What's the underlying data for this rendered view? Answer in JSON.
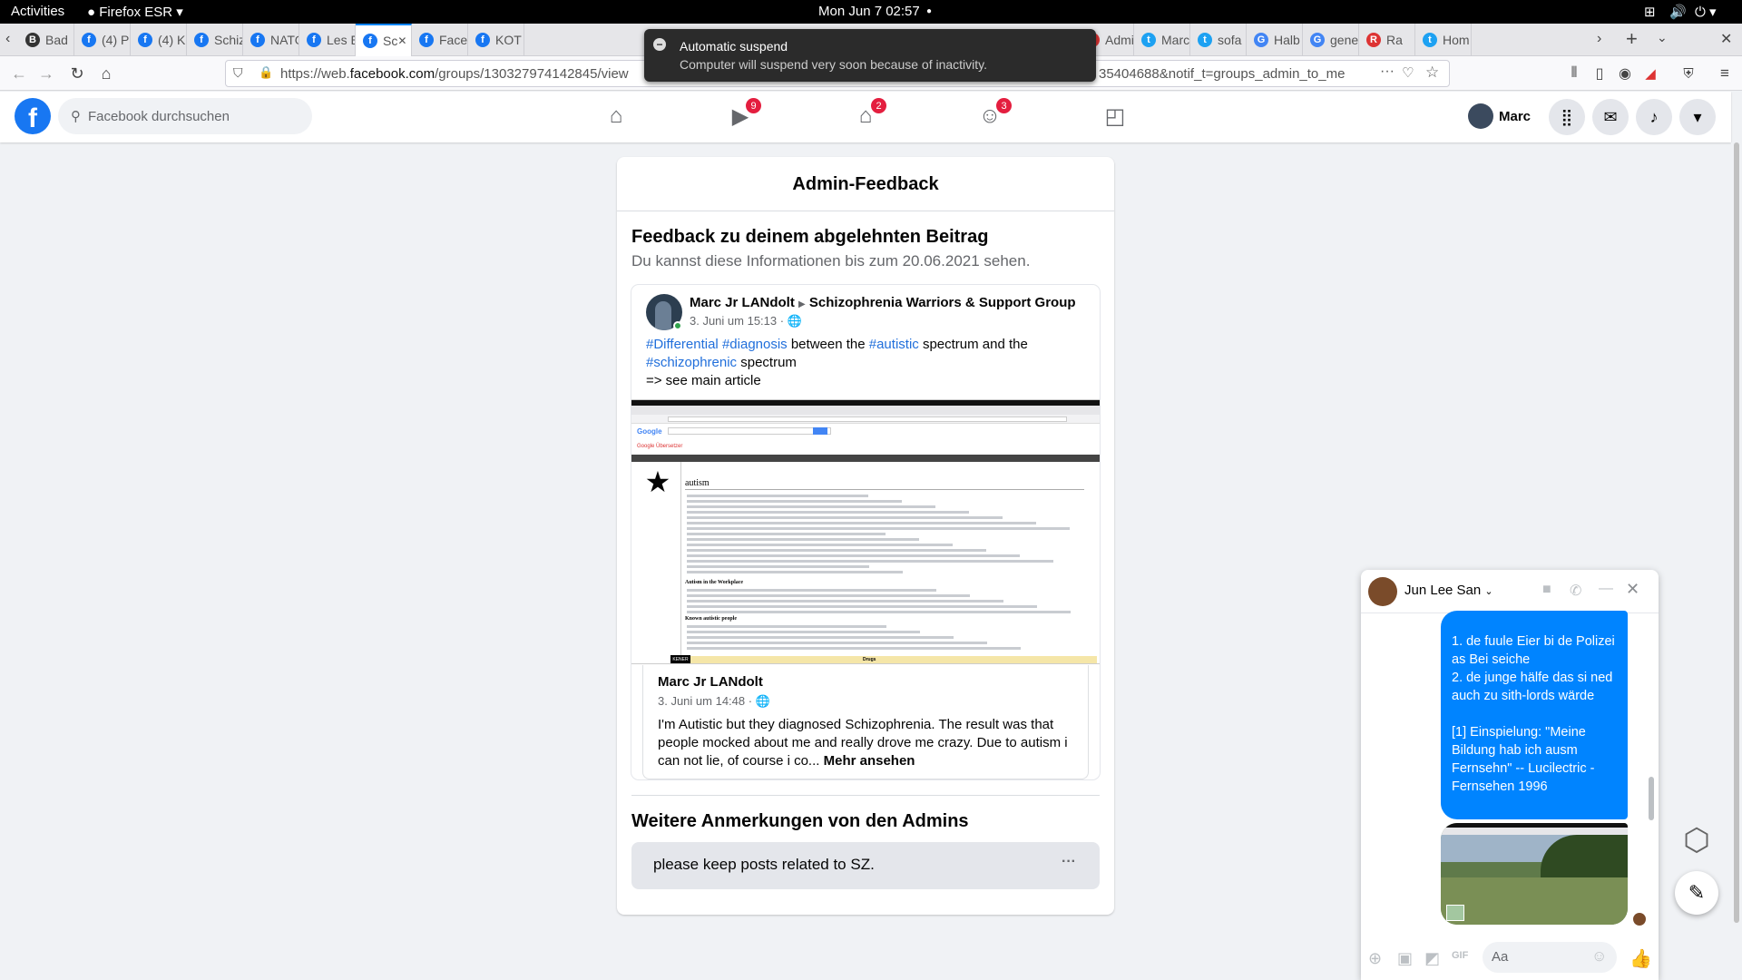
{
  "system": {
    "activities": "Activities",
    "app": "Firefox ESR",
    "clock": "Mon Jun 7  02:57"
  },
  "tabs": [
    {
      "label": "Bad",
      "icon": "B",
      "color": "#333"
    },
    {
      "label": "(4) P",
      "icon": "f",
      "color": "#1877f2"
    },
    {
      "label": "(4) K",
      "icon": "f",
      "color": "#1877f2"
    },
    {
      "label": "Schiz",
      "icon": "f",
      "color": "#1877f2"
    },
    {
      "label": "NATO",
      "icon": "f",
      "color": "#1877f2"
    },
    {
      "label": "Les E",
      "icon": "f",
      "color": "#1877f2"
    },
    {
      "label": "Sc",
      "icon": "f",
      "color": "#1877f2"
    },
    {
      "label": "Face",
      "icon": "f",
      "color": "#1877f2"
    },
    {
      "label": "KOT",
      "icon": "f",
      "color": "#1877f2"
    },
    {
      "label": "Admi",
      "icon": "",
      "color": "#d33"
    },
    {
      "label": "Marc",
      "icon": "t",
      "color": "#1da1f2"
    },
    {
      "label": "sofa",
      "icon": "t",
      "color": "#1da1f2"
    },
    {
      "label": "Halb",
      "icon": "G",
      "color": "#4285f4"
    },
    {
      "label": "gene",
      "icon": "G",
      "color": "#4285f4"
    },
    {
      "label": "Ra",
      "icon": "R",
      "color": "#d33"
    },
    {
      "label": "Hom",
      "icon": "t",
      "color": "#1da1f2"
    }
  ],
  "url": {
    "prefix": "https://web.",
    "domain": "facebook.com",
    "path": "/groups/130327974142845/view",
    "tail": "35404688&notif_t=groups_admin_to_me"
  },
  "notification": {
    "title": "Automatic suspend",
    "body": "Computer will suspend very soon because of inactivity."
  },
  "fb": {
    "search_placeholder": "Facebook durchsuchen",
    "badges": {
      "watch": "9",
      "marketplace": "2",
      "groups": "3"
    },
    "user": "Marc"
  },
  "card": {
    "title": "Admin-Feedback",
    "heading": "Feedback zu deinem abgelehnten Beitrag",
    "subheading": "Du kannst diese Informationen bis zum 20.06.2021 sehen.",
    "post": {
      "author": "Marc Jr LANdolt",
      "group": "Schizophrenia Warriors & Support Group",
      "time": "3. Juni um 15:13 ·",
      "text_line1": [
        {
          "t": "#Differential",
          "tag": true
        },
        {
          "t": " ",
          "tag": false
        },
        {
          "t": "#diagnosis",
          "tag": true
        },
        {
          "t": " between the ",
          "tag": false
        },
        {
          "t": "#autistic",
          "tag": true
        },
        {
          "t": " spectrum and the",
          "tag": false
        }
      ],
      "text_line2_tag": "#schizophrenic",
      "text_line2_rest": " spectrum",
      "text_line3": "=> see main article"
    },
    "shared": {
      "author": "Marc Jr LANdolt",
      "time": "3. Juni um 14:48 ·",
      "text": "I'm Autistic but they diagnosed Schizophrenia. The result was that people mocked about me and really drove me crazy. Due to autism i can not lie, of course i co...",
      "more": "Mehr ansehen"
    },
    "screenshot": {
      "site": "Google Übersetzer",
      "article": "autism",
      "section": "Autism in the Workplace",
      "section2": "Known autistic people",
      "banner": "Drugs",
      "logo": "KENER"
    },
    "admins_heading": "Weitere Anmerkungen von den Admins",
    "admin_comment": "please keep posts related to SZ.",
    "dots": "···"
  },
  "chat": {
    "name": "Jun Lee San",
    "message": "1. de fuule Eier bi de Polizei as Bei seiche\n2. de junge hälfe das si ned auch zu sith-lords wärde\n\n[1] Einspielung: \"Meine Bildung hab ich ausm Fernsehn\" -- Lucilectric - Fernsehen 1996",
    "input_placeholder": "Aa"
  }
}
